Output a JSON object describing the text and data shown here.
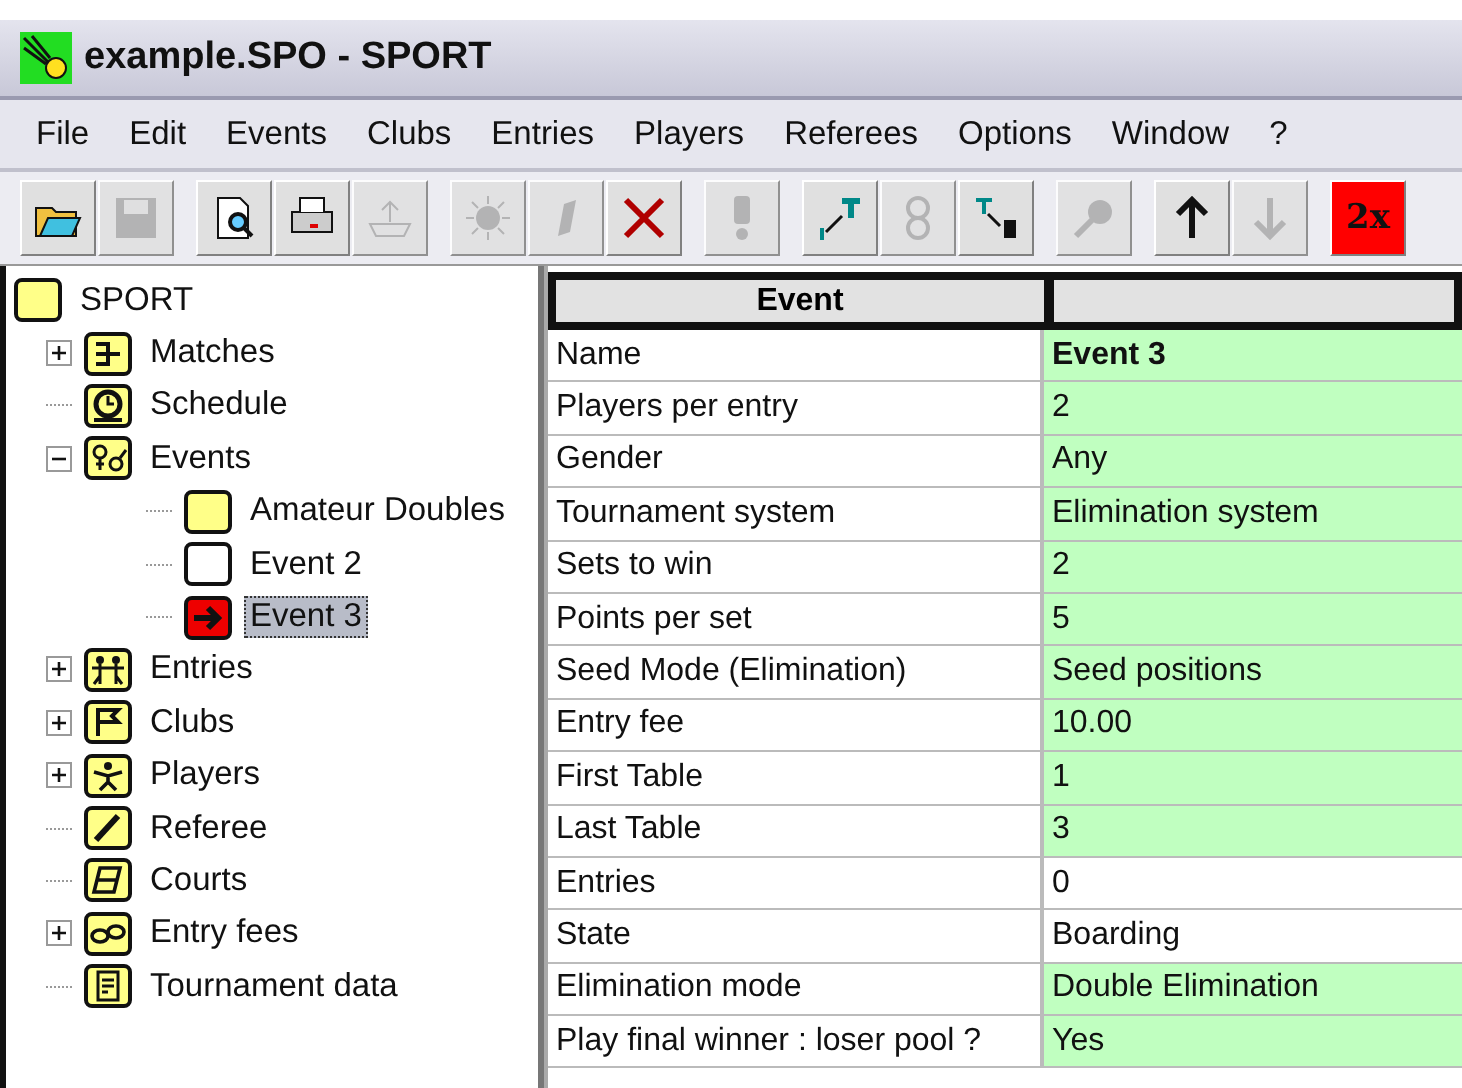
{
  "window": {
    "title": "example.SPO - SPORT"
  },
  "menu": [
    "File",
    "Edit",
    "Events",
    "Clubs",
    "Entries",
    "Players",
    "Referees",
    "Options",
    "Window",
    "?"
  ],
  "toolbar": [
    {
      "kind": "open",
      "disabled": false
    },
    {
      "kind": "save",
      "disabled": true
    },
    {
      "kind": "sep"
    },
    {
      "kind": "preview",
      "disabled": false
    },
    {
      "kind": "print",
      "disabled": false
    },
    {
      "kind": "export",
      "disabled": true
    },
    {
      "kind": "sep"
    },
    {
      "kind": "burst",
      "disabled": true
    },
    {
      "kind": "pen",
      "disabled": true
    },
    {
      "kind": "delete",
      "disabled": false
    },
    {
      "kind": "sep"
    },
    {
      "kind": "alert",
      "disabled": true
    },
    {
      "kind": "sep"
    },
    {
      "kind": "promote",
      "disabled": false
    },
    {
      "kind": "link",
      "disabled": true
    },
    {
      "kind": "demote",
      "disabled": false
    },
    {
      "kind": "sep"
    },
    {
      "kind": "search",
      "disabled": true
    },
    {
      "kind": "sep"
    },
    {
      "kind": "up",
      "disabled": false
    },
    {
      "kind": "down",
      "disabled": true
    },
    {
      "kind": "sep"
    },
    {
      "kind": "text",
      "label": "2x",
      "disabled": false
    }
  ],
  "tree": {
    "label": "SPORT",
    "kind": "blank",
    "selected": false,
    "children": [
      {
        "label": "Matches",
        "kind": "matches",
        "expanded": false,
        "selected": false
      },
      {
        "label": "Schedule",
        "kind": "clock",
        "selected": false
      },
      {
        "label": "Events",
        "kind": "gender",
        "expanded": true,
        "selected": false,
        "children": [
          {
            "label": "Amateur Doubles",
            "kind": "blank",
            "selected": false
          },
          {
            "label": "Event 2",
            "kind": "empty",
            "selected": false
          },
          {
            "label": "Event 3",
            "kind": "current",
            "selected": true
          }
        ]
      },
      {
        "label": "Entries",
        "kind": "people",
        "expanded": false,
        "selected": false
      },
      {
        "label": "Clubs",
        "kind": "flag",
        "expanded": false,
        "selected": false
      },
      {
        "label": "Players",
        "kind": "person",
        "expanded": false,
        "selected": false
      },
      {
        "label": "Referee",
        "kind": "pen",
        "selected": false
      },
      {
        "label": "Courts",
        "kind": "court",
        "selected": false
      },
      {
        "label": "Entry fees",
        "kind": "coins",
        "expanded": false,
        "selected": false
      },
      {
        "label": "Tournament data",
        "kind": "sheet",
        "selected": false
      }
    ]
  },
  "table": {
    "columns": [
      "Event"
    ],
    "rows": [
      {
        "label": "Name",
        "value": "Event 3",
        "editable": true,
        "strong": true
      },
      {
        "label": "Players per entry",
        "value": "2",
        "editable": true
      },
      {
        "label": "Gender",
        "value": "Any",
        "editable": true
      },
      {
        "label": "Tournament system",
        "value": "Elimination system",
        "editable": true
      },
      {
        "label": "Sets to win",
        "value": "2",
        "editable": true
      },
      {
        "label": "Points per set",
        "value": "5",
        "editable": true
      },
      {
        "label": "Seed Mode (Elimination)",
        "value": "Seed positions",
        "editable": true
      },
      {
        "label": "Entry fee",
        "value": "10.00",
        "editable": true
      },
      {
        "label": "First Table",
        "value": "1",
        "editable": true
      },
      {
        "label": "Last Table",
        "value": "3",
        "editable": true
      },
      {
        "label": "Entries",
        "value": "0",
        "editable": false
      },
      {
        "label": "State",
        "value": "Boarding",
        "editable": false
      },
      {
        "label": "Elimination mode",
        "value": "Double Elimination",
        "editable": true
      },
      {
        "label": "Play final winner : loser pool ?",
        "value": "Yes",
        "editable": true
      }
    ]
  }
}
